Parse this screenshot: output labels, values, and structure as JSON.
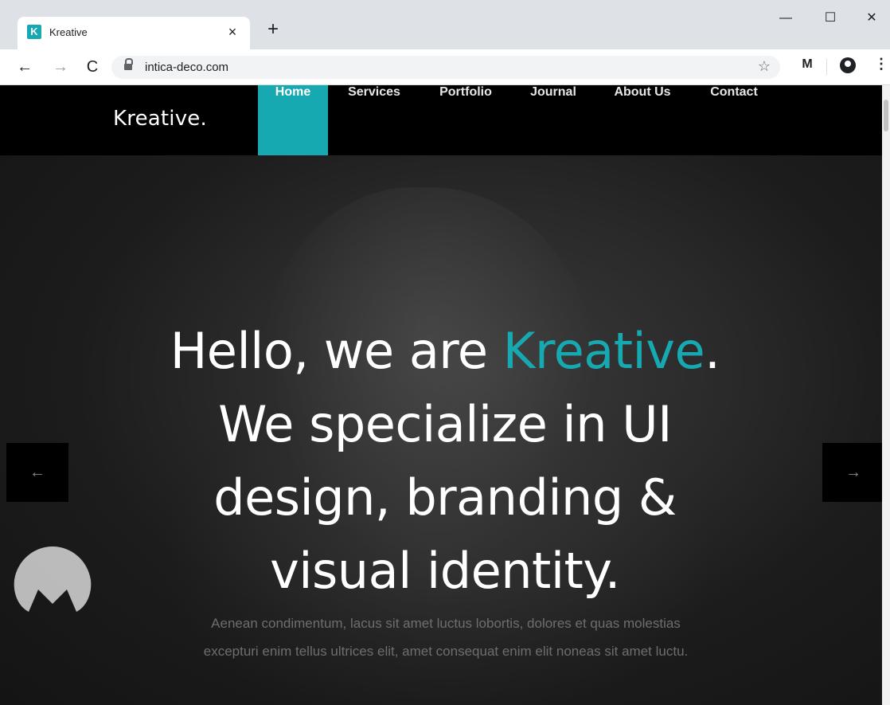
{
  "browser": {
    "tab_title": "Kreative",
    "tab_favicon_letter": "K",
    "url": "intica-deco.com",
    "icons": {
      "back": "←",
      "forward": "→",
      "reload": "C",
      "star": "☆",
      "extension": "M",
      "menu": "⋮",
      "close": "×",
      "new_tab": "+",
      "minimize": "—",
      "maximize": "☐",
      "window_close": "✕"
    }
  },
  "site": {
    "logo": "Kreative.",
    "menu": [
      {
        "label": "Home",
        "active": true
      },
      {
        "label": "Services"
      },
      {
        "label": "Portfolio"
      },
      {
        "label": "Journal"
      },
      {
        "label": "About Us"
      },
      {
        "label": "Contact"
      }
    ],
    "hero": {
      "line1_pre": "Hello, we are ",
      "line1_accent": "Kreative",
      "line1_post": ".",
      "line2": "We specialize in UI",
      "line3": "design, branding &",
      "line4": "visual identity.",
      "subtext": "Aenean condimentum, lacus sit amet luctus lobortis, dolores et quas molestias excepturi enim tellus ultrices elit, amet consequat enim elit noneas sit amet luctu.",
      "prev_arrow": "←",
      "next_arrow": "→"
    },
    "accent_color": "#17a9b1"
  }
}
